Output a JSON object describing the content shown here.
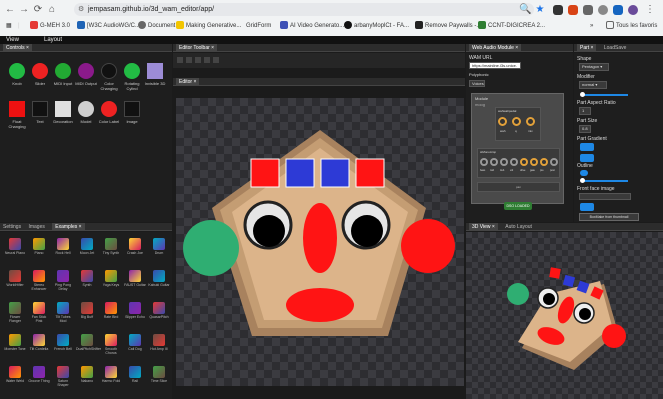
{
  "browser": {
    "url": "jempasam.github.io/3d_wam_editor/app/",
    "bookmarks": [
      "G-MEH 3.0",
      "[W3C AudioWG/C...",
      "Document",
      "Making Generative...",
      "GridForm",
      "AI Video Generato...",
      "arbanyMoplCt - FA...",
      "Remove Paywalls -...",
      "CCNT-DIGICREA 2..."
    ],
    "all_bookmarks": "Tous les favoris",
    "more": "»"
  },
  "menu": {
    "view": "View",
    "layout": "Layout"
  },
  "controls_panel": {
    "tab": "Controls",
    "items": [
      {
        "label": "Knob",
        "color": "#22bb44",
        "shape": "circle"
      },
      {
        "label": "Slider",
        "color": "#ee2222",
        "shape": "circle"
      },
      {
        "label": "MIDI Input",
        "color": "#22aa33",
        "shape": "circle"
      },
      {
        "label": "MIDI Output",
        "color": "#8b1a8b",
        "shape": "circle"
      },
      {
        "label": "Color Changing",
        "color": "#111111",
        "shape": "circle"
      },
      {
        "label": "Rotating Cylind",
        "color": "#22bb44",
        "shape": "circle"
      },
      {
        "label": "Invisible 3D",
        "color": "#9c8cd6",
        "shape": "square"
      },
      {
        "label": "Float Changing",
        "color": "#ee1111",
        "shape": "square"
      },
      {
        "label": "Text",
        "color": "#111111",
        "shape": "square"
      },
      {
        "label": "Decoration",
        "color": "#e0e0e0",
        "shape": "square"
      },
      {
        "label": "Model",
        "color": "#cfcfcf",
        "shape": "circle"
      },
      {
        "label": "Color Label",
        "color": "#ee2222",
        "shape": "circle"
      },
      {
        "label": "Image",
        "color": "#111111",
        "shape": "square"
      }
    ]
  },
  "examples_panel": {
    "tabs": [
      "Settings",
      "Images",
      "Examples"
    ],
    "items": [
      "Neural Piano",
      "Piano",
      "Rock Hell",
      "Moon Jet",
      "Tiny Synth",
      "Crash Joe",
      "Drum",
      "WorldHifier",
      "Stereo Enhancer",
      "Ping Pong Delay",
      "Synth",
      "Yoga Keys",
      "FAUST Guitar",
      "Kabuki Guitar",
      "Flower Flanger",
      "Fan Stick Pink",
      "Tilt Tubes Mod",
      "Big Buff",
      "Rate Bird",
      "Slipper Echo",
      "QuasarPitch",
      "Monster Tone",
      "Tilt Cordelia",
      "French Bell",
      "DualPitchShifter",
      "Smooth Chorus",
      "Cali Dog",
      "Hot Amp III",
      "Water Weld",
      "Groove Thing",
      "Saturn Shaper",
      "Nakano",
      "Harmo Fold",
      "Rail",
      "Time Slice"
    ]
  },
  "editor_toolbar": {
    "tab": "Editor Toolbar"
  },
  "editor": {
    "tab": "Editor"
  },
  "wam_panel": {
    "tab": "Web Audio Module",
    "url_label": "WAM URL",
    "url_value": "https://mainline.i3s.unice.",
    "polyphonic_label": "Polyphonic",
    "voices_value": "Voices",
    "module_title": "Module",
    "module_name": "moog",
    "knobs_title": "wahwahpedal",
    "sub_title": "stMonoAmp",
    "knob_labels": [
      "wah",
      "q",
      "mix"
    ],
    "knob_labels_2": [
      "bass",
      "mid",
      "treb",
      "vol",
      "drive",
      "gate",
      "pre",
      "post"
    ],
    "footer": "pan",
    "loaded_button": "DSO LOADED"
  },
  "view3d": {
    "tabs": [
      "3D View",
      "Auto Layout"
    ]
  },
  "right_panel": {
    "tabs": [
      "Part",
      "LoadSave"
    ],
    "shape_label": "Shape",
    "shape_value": "Pentagon",
    "modifier_label": "Modifier",
    "modifier_value": "normal",
    "aspect_label": "Part Aspect Ratio",
    "aspect_value": "1",
    "size_label": "Part Size",
    "size_value": "0.8",
    "gradient_label": "Part Gradient",
    "outline_label": "Outline",
    "front_face_label": "Front face image",
    "button_label": "BoxMake from thumbnail"
  },
  "colors": {
    "pentagon_outer": "#a8825e",
    "pentagon_mid": "#c49d73",
    "pentagon_inner": "#dcb48a",
    "red": "#ff1414",
    "blue": "#2d3ad6",
    "green": "#2fae72",
    "accent": "#1e88e5"
  }
}
